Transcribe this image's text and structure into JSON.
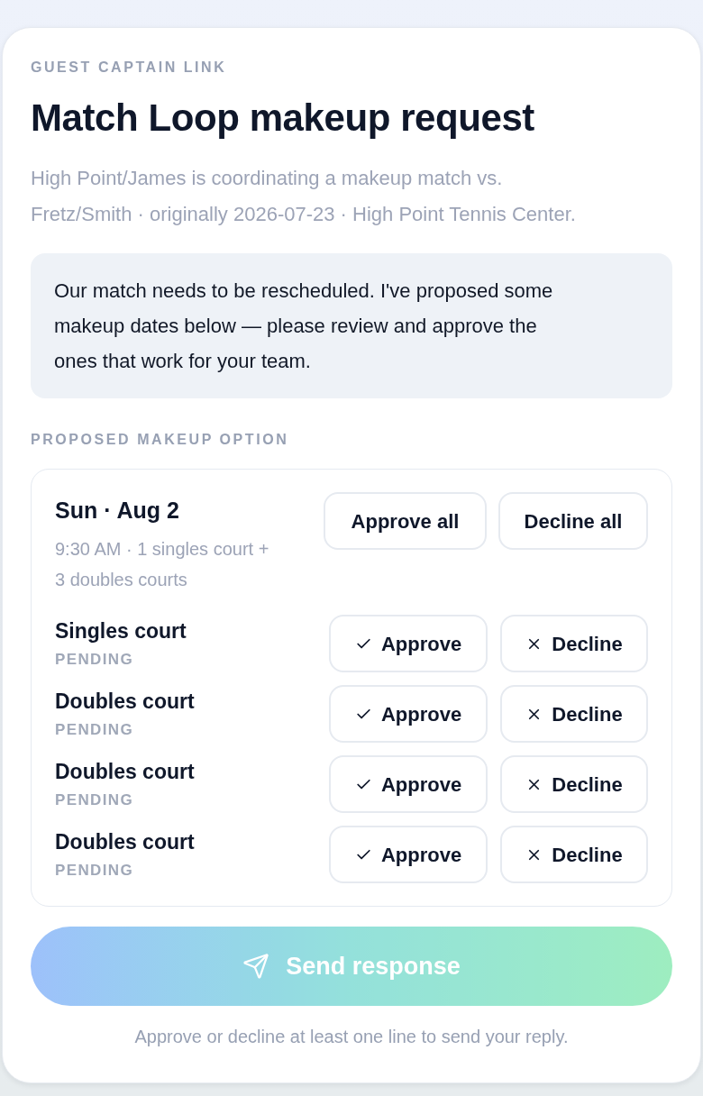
{
  "eyebrow": "GUEST CAPTAIN LINK",
  "title": "Match Loop makeup request",
  "description": "High Point/James is coordinating a makeup match vs. Fretz/Smith · originally 2026-07-23 · High Point Tennis Center.",
  "message": "Our match needs to be rescheduled. I've proposed some makeup dates below — please review and approve the ones that work for your team.",
  "section_label": "PROPOSED MAKEUP OPTION",
  "option": {
    "date": "Sun · Aug 2",
    "details": "9:30 AM · 1 singles court + 3 doubles courts",
    "bulk_actions": [
      "Approve all",
      "Decline all"
    ],
    "lines": [
      {
        "name": "Singles court",
        "status": "PENDING",
        "approve": "Approve",
        "decline": "Decline"
      },
      {
        "name": "Doubles court",
        "status": "PENDING",
        "approve": "Approve",
        "decline": "Decline"
      },
      {
        "name": "Doubles court",
        "status": "PENDING",
        "approve": "Approve",
        "decline": "Decline"
      },
      {
        "name": "Doubles court",
        "status": "PENDING",
        "approve": "Approve",
        "decline": "Decline"
      }
    ]
  },
  "send_button": {
    "label": "Send response",
    "disabled": true
  },
  "hint": "Approve or decline at least one line to send your reply."
}
